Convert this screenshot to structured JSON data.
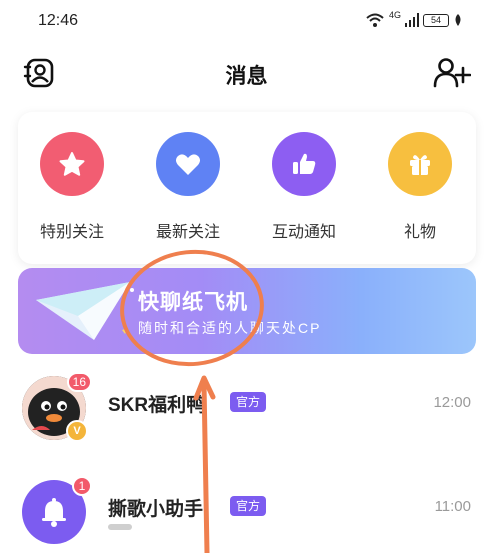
{
  "status_bar": {
    "time": "12:46",
    "network": "4G",
    "battery": "54"
  },
  "header": {
    "title": "消息",
    "left_icon": "contacts-icon",
    "right_icon": "add-friend-icon"
  },
  "quick_actions": [
    {
      "label": "特别关注",
      "icon": "star-icon",
      "color": "#f25d72"
    },
    {
      "label": "最新关注",
      "icon": "heart-icon",
      "color": "#5f82f4"
    },
    {
      "label": "互动通知",
      "icon": "thumbs-up-icon",
      "color": "#8d5ef2"
    },
    {
      "label": "礼物",
      "icon": "gift-icon",
      "color": "#f7bf3f"
    }
  ],
  "banner": {
    "title": "快聊纸飞机",
    "subtitle": "随时和合适的人聊天处CP"
  },
  "messages": [
    {
      "name": "SKR福利鸭",
      "tag": "官方",
      "time": "12:00",
      "unread": "16",
      "vip": "V"
    },
    {
      "name": "撕歌小助手",
      "tag": "官方",
      "time": "11:00",
      "unread": "1"
    }
  ],
  "colors": {
    "accent": "#7c5cf0",
    "badge": "#f25a6a",
    "annotation": "#ef7f4e"
  }
}
